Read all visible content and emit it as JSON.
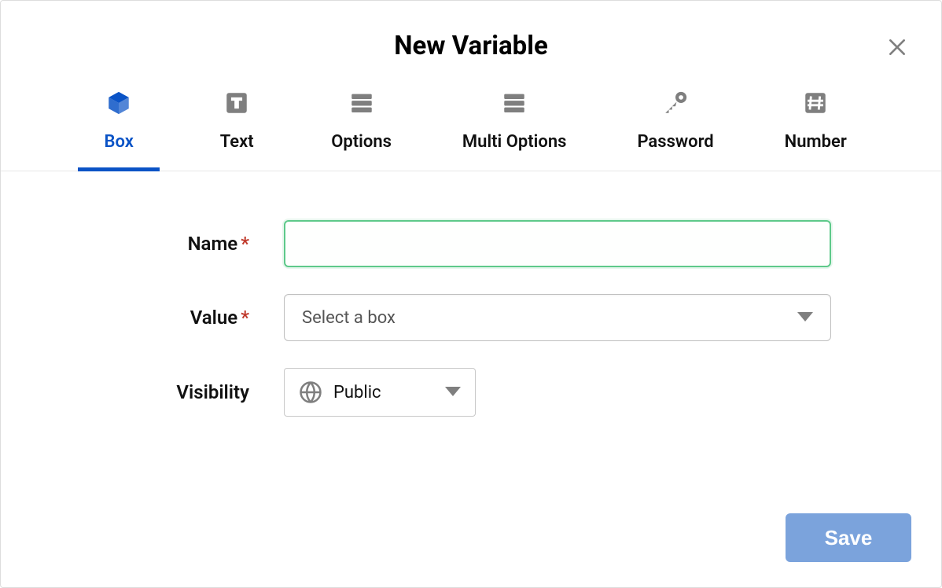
{
  "modal": {
    "title": "New Variable",
    "close": "Close"
  },
  "tabs": {
    "box": "Box",
    "text": "Text",
    "options": "Options",
    "multi_options": "Multi Options",
    "password": "Password",
    "number": "Number",
    "active": "box"
  },
  "form": {
    "name_label": "Name",
    "name_value": "",
    "value_label": "Value",
    "value_placeholder": "Select a box",
    "visibility_label": "Visibility",
    "visibility_value": "Public",
    "required_mark": "*"
  },
  "actions": {
    "save": "Save"
  }
}
